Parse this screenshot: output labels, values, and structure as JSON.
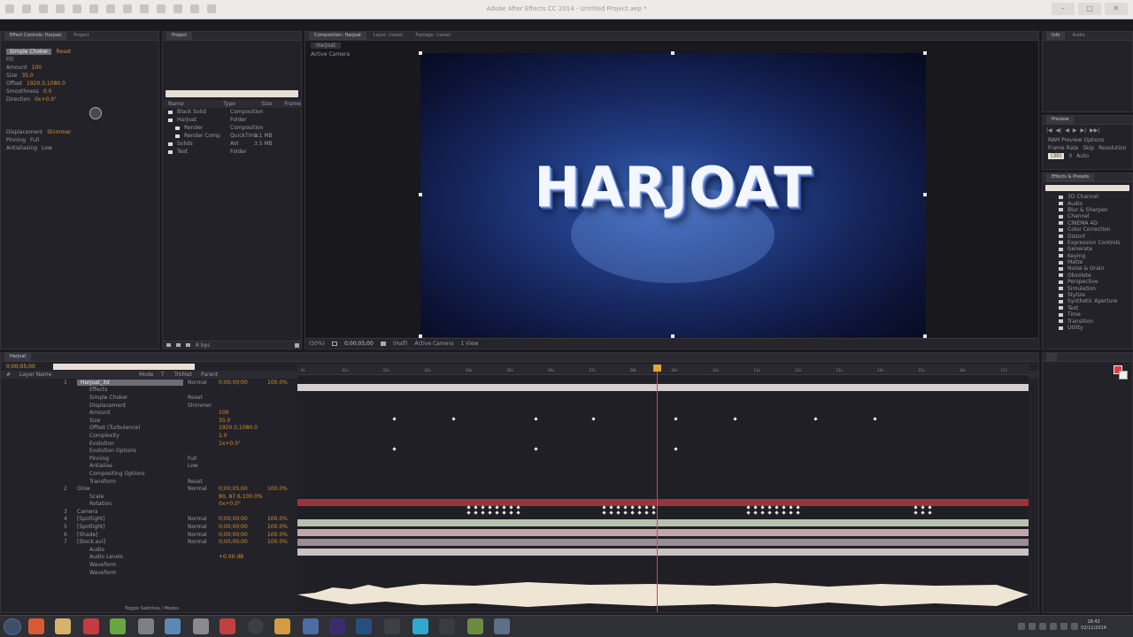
{
  "window": {
    "title": "Adobe After Effects CC 2014 - Untitled Project.aep *"
  },
  "effect_controls": {
    "tabs": [
      "Effect Controls: Harjoat",
      "Project"
    ],
    "rows": [
      {
        "label": "Simple Choker",
        "value": "Reset"
      },
      {
        "label": "Fill",
        "value": ""
      },
      {
        "label": "Amount",
        "value": "100"
      },
      {
        "label": "Size",
        "value": "35.0"
      },
      {
        "label": "Offset",
        "value": "1920.0,1080.0"
      },
      {
        "label": "Smoothness",
        "value": "0.0"
      },
      {
        "label": "Direction",
        "value": "0x+0.0°"
      }
    ],
    "sub_rows": [
      {
        "label": "Displacement",
        "value": "Shimmer"
      },
      {
        "label": "Pinning",
        "value": "Full"
      },
      {
        "label": "Antialiasing",
        "value": "Low"
      }
    ]
  },
  "project": {
    "search_placeholder": "Search",
    "columns": [
      "Name",
      "Type",
      "Size",
      "Frame"
    ],
    "items": [
      {
        "name": "Black Solid",
        "type": "Composition",
        "size": ""
      },
      {
        "name": "Harjoat",
        "type": "Folder",
        "size": ""
      },
      {
        "name": "Render",
        "type": "Composition",
        "size": ""
      },
      {
        "name": "Render Comp",
        "type": "Composition",
        "size": ""
      },
      {
        "name": "Solids",
        "type": "Folder",
        "size": ""
      },
      {
        "name": "Glow",
        "type": "QuickTime",
        "size": "1.1 MB"
      },
      {
        "name": "Stock",
        "type": "AVI",
        "size": "3.5 MB"
      },
      {
        "name": "Text",
        "type": "Folder",
        "size": ""
      }
    ],
    "bit_depth": "8 bpc"
  },
  "composition": {
    "tabs": [
      "Composition: Harjoat",
      "Layer: (none)",
      "Footage: (none)"
    ],
    "crumb": "Harjoat",
    "camera": "Active Camera",
    "headline": "HARJOAT",
    "bottom": {
      "zoom": "(50%)",
      "timecode": "0;00;05;00",
      "res": "(Half)",
      "view": "Active Camera",
      "views": "1 View"
    }
  },
  "right_panels": {
    "info_tabs": [
      "Info",
      "Audio"
    ],
    "preview_tab": "Preview",
    "preview_buttons": [
      "|◀",
      "◀|",
      "◀",
      "▶",
      "▶|",
      "▶▶|"
    ],
    "ram_preview": "RAM Preview Options",
    "fps_labels": [
      "Frame Rate",
      "Skip",
      "Resolution"
    ],
    "fps_values": [
      "(30)",
      "0",
      "Auto"
    ],
    "effects_tab": "Effects & Presets",
    "effects_search": "",
    "effects": [
      "3D Channel",
      "Audio",
      "Blur & Sharpen",
      "Channel",
      "CINEMA 4D",
      "Color Correction",
      "Distort",
      "Expression Controls",
      "Generate",
      "Keying",
      "Matte",
      "Noise & Grain",
      "Obsolete",
      "Perspective",
      "Simulation",
      "Stylize",
      "Synthetic Aperture",
      "Text",
      "Time",
      "Transition",
      "Utility"
    ],
    "paragraph_tab": "Paint",
    "accent": "#e23b3f"
  },
  "timeline": {
    "tab": "Harjoat",
    "timecode": "0;00;05;00",
    "search_placeholder": "",
    "columns": [
      "#",
      "Layer Name",
      "Mode",
      "T",
      "TrkMat",
      "Parent"
    ],
    "layers": [
      {
        "num": "1",
        "name": "Harjoat_3d",
        "mode": "Normal",
        "value": "0;00;00;00",
        "extra": "100.0%"
      },
      {
        "num": "",
        "name": "Effects",
        "mode": "",
        "value": "",
        "extra": ""
      },
      {
        "num": "",
        "name": "Simple Choker",
        "mode": "Reset",
        "value": "",
        "extra": ""
      },
      {
        "num": "",
        "name": "Displacement",
        "mode": "Shimmer",
        "value": "",
        "extra": ""
      },
      {
        "num": "",
        "name": "Amount",
        "mode": "",
        "value": "100",
        "extra": ""
      },
      {
        "num": "",
        "name": "Size",
        "mode": "",
        "value": "35.0",
        "extra": ""
      },
      {
        "num": "",
        "name": "Offset (Turbulence)",
        "mode": "",
        "value": "1920.0,1080.0",
        "extra": ""
      },
      {
        "num": "",
        "name": "Complexity",
        "mode": "",
        "value": "1.0",
        "extra": ""
      },
      {
        "num": "",
        "name": "Evolution",
        "mode": "",
        "value": "1x+0.0°",
        "extra": ""
      },
      {
        "num": "",
        "name": "Evolution Options",
        "mode": "",
        "value": "",
        "extra": ""
      },
      {
        "num": "",
        "name": "Pinning",
        "mode": "Full",
        "value": "",
        "extra": ""
      },
      {
        "num": "",
        "name": "Antialias",
        "mode": "Low",
        "value": "",
        "extra": ""
      },
      {
        "num": "",
        "name": "Compositing Options",
        "mode": "",
        "value": "",
        "extra": ""
      },
      {
        "num": "",
        "name": "Transform",
        "mode": "Reset",
        "value": "",
        "extra": ""
      },
      {
        "num": "2",
        "name": "Glow",
        "mode": "Normal",
        "value": "0;00;05;00",
        "extra": "100.0%"
      },
      {
        "num": "",
        "name": "Scale",
        "mode": "",
        "value": "80, 87.6,100.0%",
        "extra": ""
      },
      {
        "num": "",
        "name": "Rotation",
        "mode": "",
        "value": "0x+0.0°",
        "extra": ""
      },
      {
        "num": "3",
        "name": "Camera",
        "mode": "",
        "value": "",
        "extra": ""
      },
      {
        "num": "4",
        "name": "[Spotlight]",
        "mode": "Normal",
        "value": "0;00;00;00",
        "extra": "100.0%"
      },
      {
        "num": "5",
        "name": "[Spotlight]",
        "mode": "Normal",
        "value": "0;00;00;00",
        "extra": "100.0%"
      },
      {
        "num": "6",
        "name": "[Shade]",
        "mode": "Normal",
        "value": "0;00;00;00",
        "extra": "100.0%"
      },
      {
        "num": "7",
        "name": "[Stock.avi]",
        "mode": "Normal",
        "value": "0;00;00;00",
        "extra": "100.0%"
      },
      {
        "num": "",
        "name": "Audio",
        "mode": "",
        "value": "",
        "extra": ""
      },
      {
        "num": "",
        "name": "Audio Levels",
        "mode": "",
        "value": "+0.00 dB",
        "extra": ""
      },
      {
        "num": "",
        "name": "Waveform",
        "mode": "",
        "value": "",
        "extra": ""
      },
      {
        "num": "",
        "name": "Waveform",
        "mode": "",
        "value": "",
        "extra": ""
      }
    ],
    "toggle_label": "Toggle Switches / Modes",
    "ruler_ticks": [
      "0s",
      "01s",
      "02s",
      "03s",
      "04s",
      "05s",
      "06s",
      "07s",
      "08s",
      "09s",
      "10s",
      "11s",
      "12s",
      "13s",
      "14s",
      "15s",
      "16s",
      "17s"
    ],
    "playhead_time": 5.0
  },
  "taskbar": {
    "time": "18:42",
    "date": "02/11/2014"
  }
}
